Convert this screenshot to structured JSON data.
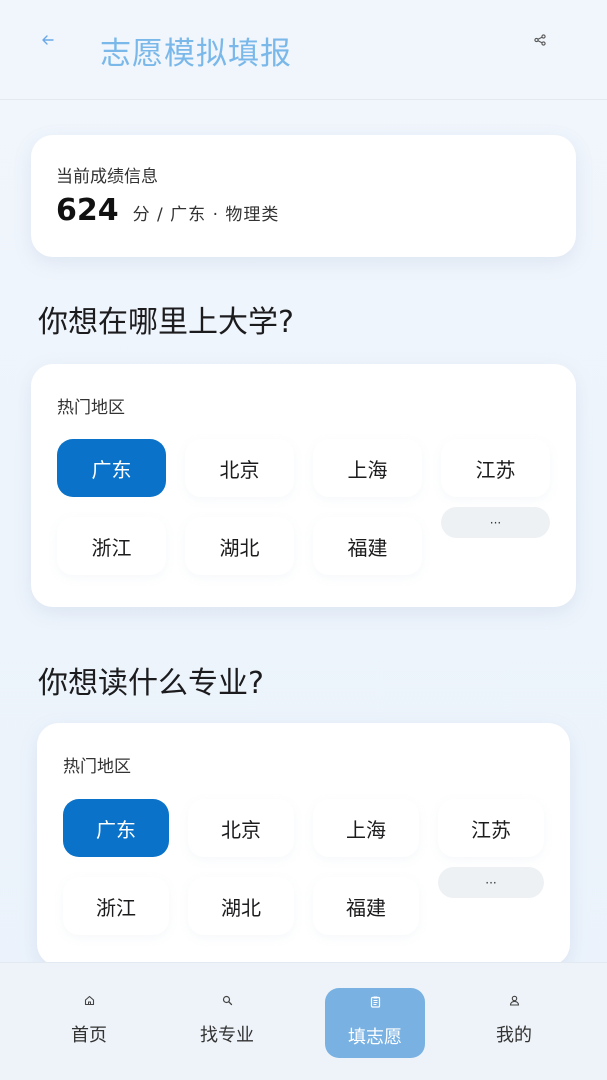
{
  "header": {
    "title": "志愿模拟填报",
    "back_icon": "back-arrow-icon",
    "share_icon": "share-icon"
  },
  "score": {
    "label": "当前成绩信息",
    "value": "624",
    "detail": "分 / 广东 · 物理类"
  },
  "section1": {
    "title": "你想在哪里上大学?",
    "card_label": "热门地区",
    "chips": [
      "广东",
      "北京",
      "上海",
      "江苏",
      "浙江",
      "湖北",
      "福建",
      "···"
    ],
    "active_index": 0
  },
  "section2": {
    "title": "你想读什么专业?",
    "card_label": "热门地区",
    "chips": [
      "广东",
      "北京",
      "上海",
      "江苏",
      "浙江",
      "湖北",
      "福建",
      "···"
    ],
    "active_index": 0
  },
  "tabbar": {
    "items": [
      {
        "label": "首页",
        "icon": "home-icon"
      },
      {
        "label": "找专业",
        "icon": "search-icon"
      },
      {
        "label": "填志愿",
        "icon": "clipboard-icon"
      },
      {
        "label": "我的",
        "icon": "user-icon"
      }
    ],
    "active_index": 2
  },
  "colors": {
    "accent": "#0a73c9",
    "title": "#7ab8ea",
    "tab_active": "#79b2e2"
  }
}
